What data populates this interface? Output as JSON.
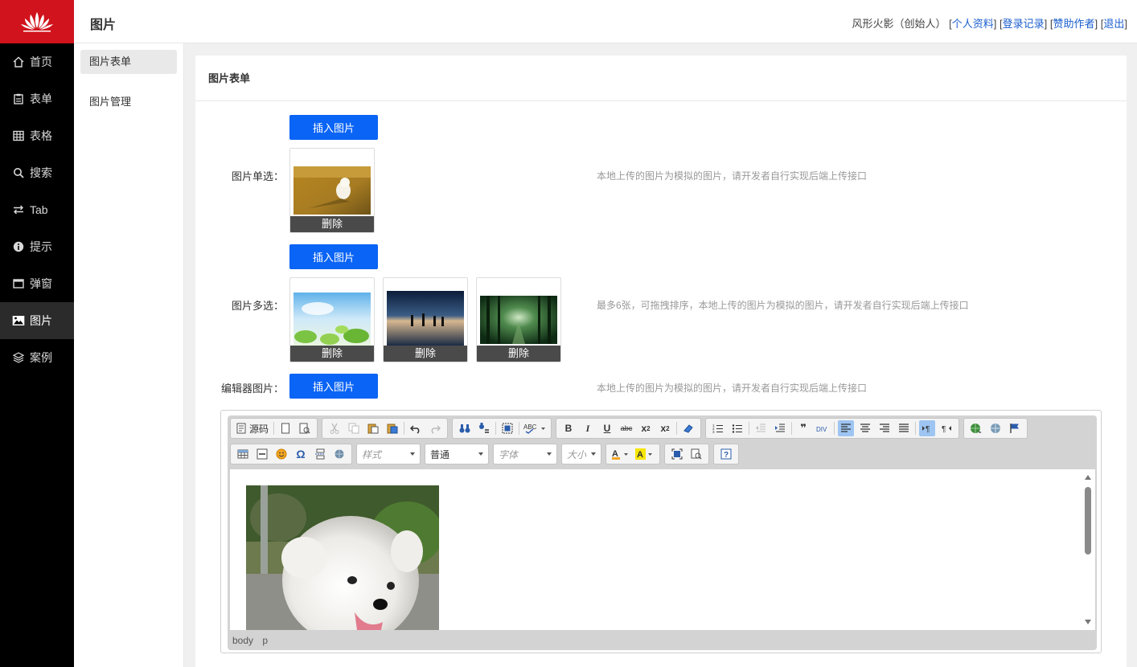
{
  "header": {
    "title": "图片",
    "user": "风形火影（创始人）",
    "links": [
      "个人资料",
      "登录记录",
      "赞助作者",
      "退出"
    ]
  },
  "sidebar": {
    "items": [
      {
        "label": "首页",
        "icon": "home-icon"
      },
      {
        "label": "表单",
        "icon": "clipboard-icon"
      },
      {
        "label": "表格",
        "icon": "grid-icon"
      },
      {
        "label": "搜索",
        "icon": "search-icon"
      },
      {
        "label": "Tab",
        "icon": "swap-icon"
      },
      {
        "label": "提示",
        "icon": "info-icon"
      },
      {
        "label": "弹窗",
        "icon": "window-icon"
      },
      {
        "label": "图片",
        "icon": "image-icon",
        "active": true
      },
      {
        "label": "案例",
        "icon": "layers-icon"
      }
    ]
  },
  "subnav": {
    "items": [
      "图片表单",
      "图片管理"
    ],
    "active": "图片表单"
  },
  "panel": {
    "title": "图片表单",
    "single": {
      "label": "图片单选：",
      "button": "插入图片",
      "delete": "删除",
      "hint": "本地上传的图片为模拟的图片，请开发者自行实现后端上传接口"
    },
    "multi": {
      "label": "图片多选：",
      "button": "插入图片",
      "delete": "删除",
      "hint": "最多6张，可拖拽排序，本地上传的图片为模拟的图片，请开发者自行实现后端上传接口"
    },
    "editor": {
      "label": "编辑器图片：",
      "button": "插入图片",
      "hint": "本地上传的图片为模拟的图片，请开发者自行实现后端上传接口",
      "source_label": "源码",
      "combos": {
        "style": "样式",
        "format": "普通",
        "font": "字体",
        "size": "大小"
      },
      "path": [
        "body",
        "p"
      ]
    }
  },
  "colors": {
    "logo_red": "#d0131c",
    "primary_blue": "#0a64f5",
    "link_blue": "#1b5fcf"
  }
}
